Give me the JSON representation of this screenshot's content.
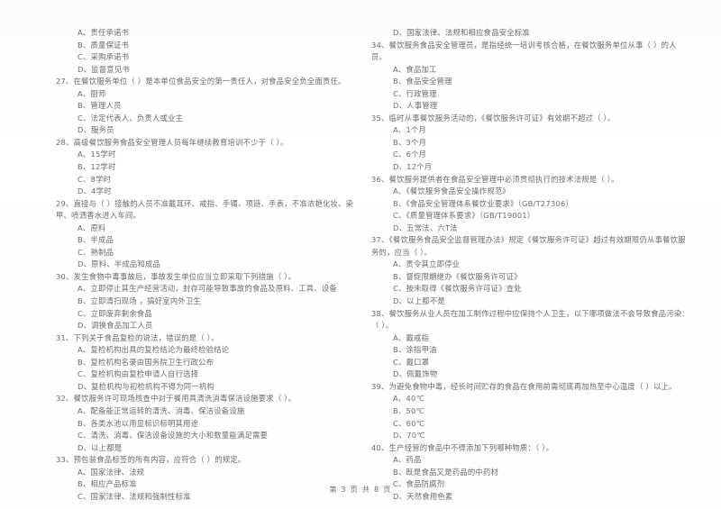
{
  "document": {
    "page_label": "第 3 页  共 8 页",
    "page_number": 3,
    "total_pages": 8,
    "ink_color": "#606060",
    "paper_color": "#ffffff"
  },
  "left_column": {
    "orphan_options": [
      "A、责任承诺书",
      "B、质量保证书",
      "C、采购承诺书",
      "D、监督意见书"
    ],
    "questions": [
      {
        "stem": "27、在餐饮服务单位（     ）是本单位食品安全的第一责任人，对食品安全负全面责任。",
        "continuation": "",
        "options": [
          "A、厨师",
          "B、管理人员",
          "C、法定代表人、负责人或业主",
          "D、服务员"
        ]
      },
      {
        "stem": "28、高级餐饮服务食品安全管理人员每年继续教育培训不少于（     ）。",
        "continuation": "",
        "options": [
          "A、15学时",
          "B、12学时",
          "C、8学时",
          "D、4学时"
        ]
      },
      {
        "stem": "29、直接与（     ）接触的人员不准戴耳环、戒指、手镯、项链、手表，不准浓艳化妆、染",
        "continuation": "甲、喷洒香水进入车间。",
        "options": [
          "A、原料",
          "B、半成品",
          "C、熟制品",
          "D、原料、半成品和成品"
        ]
      },
      {
        "stem": "30、发生食物中毒事故后，事故发生单位应当立即采取下列措施（     ）。",
        "continuation": "",
        "options": [
          "A、立即停止其生产经营活动，封存可能导致事故的食品及原料、工具、设备",
          "B、立即清扫现场 ，搞好室内外卫生",
          "C、立即废弃剩余食品",
          "D、调换食品加工人员"
        ]
      },
      {
        "stem": "31、下列关于食品复检的说法，错误的是（     ）。",
        "continuation": "",
        "options": [
          "A、复检机构出具的复检结论为最终检验结论",
          "B、复检机构名录由国务院卫生行政公布",
          "C、复检机构由复检申请人自行选择",
          "D、复检机构与初检机构不得为同一机构"
        ]
      },
      {
        "stem": "32、餐饮服务许可现场核查中对于餐用具清洗消毒保洁设施要求（     ）。",
        "continuation": "",
        "options": [
          "A、配备能正常运转的清洗、消毒、保洁设备设施",
          "B、各类水池以用显标识标明其用途",
          "C、清洗、消毒、保洁设备设施的大小和数量能满足需要",
          "D、以上都是"
        ]
      },
      {
        "stem": "33、预包装食品标签的所有内容，应符合（     ）的规定。",
        "continuation": "",
        "options": [
          "A、国家法律、法规",
          "B、相应产品标准",
          "C、国家法律、法规和强制性标准"
        ]
      }
    ]
  },
  "right_column": {
    "orphan_options": [
      "D、国家法律、法规和相应食品安全标准"
    ],
    "questions": [
      {
        "stem": "34、餐饮服务食品安全管理员，是指经统一培训考核合格，在餐饮服务单位从事（     ）的人",
        "continuation": "员。",
        "options": [
          "A、食品加工",
          "B、食品安全管理",
          "C、行政管理",
          "D、人事管理"
        ]
      },
      {
        "stem": "35、临时从事餐饮服务活动的，《餐饮服务许可证》有效期不超过（     ）。",
        "continuation": "",
        "options": [
          "A、1个月",
          "B、3个月",
          "C、6个月",
          "D、12个月"
        ]
      },
      {
        "stem": "36、餐饮服务提供者在食品安全管理中必须贯彻执行的技术法规是（     ）。",
        "continuation": "",
        "options": [
          "A、《餐饮服务食品安全操作规范》",
          "B、《食品安全管理体系餐饮业要求》（GB/T27306）",
          "C、《质量管理体系要求》（GB/T19001）",
          "D、五常法、六T法"
        ]
      },
      {
        "stem": "37、《餐饮服务食品安全监督管理办法》规定《餐饮服务许可证》超过有效期限仍从事餐饮服",
        "continuation": "务的，应当（     ）。",
        "options": [
          "A、责令其立即停业",
          "B、督促限期继办《餐饮服务许可证》",
          "C、按未取得《餐饮服务许可证》查处",
          "D、以上都不是"
        ]
      },
      {
        "stem": "38、餐饮服务从业人员在加工制作过程中应保持个人卫生，以下哪项做法不会导致食品污染：",
        "continuation": "（     ）。",
        "options": [
          "A、戴戒指",
          "B、涂指甲油",
          "C、戴口罩",
          "D、佩戴饰物"
        ]
      },
      {
        "stem": "39、为避免食物中毒，经长时间贮存的食品在食用前需彻底再加热至中心温度（     ）以上。",
        "continuation": "",
        "options": [
          "A、40℃",
          "B、50℃",
          "C、60℃",
          "D、70℃"
        ]
      },
      {
        "stem": "40、生产经营的食品中不得添加下列哪种物质：（     ）。",
        "continuation": "",
        "options": [
          "A、药品",
          "B、既是食品又是药品的中药材",
          "C、食品防腐剂",
          "D、天然食用色素"
        ]
      }
    ]
  }
}
